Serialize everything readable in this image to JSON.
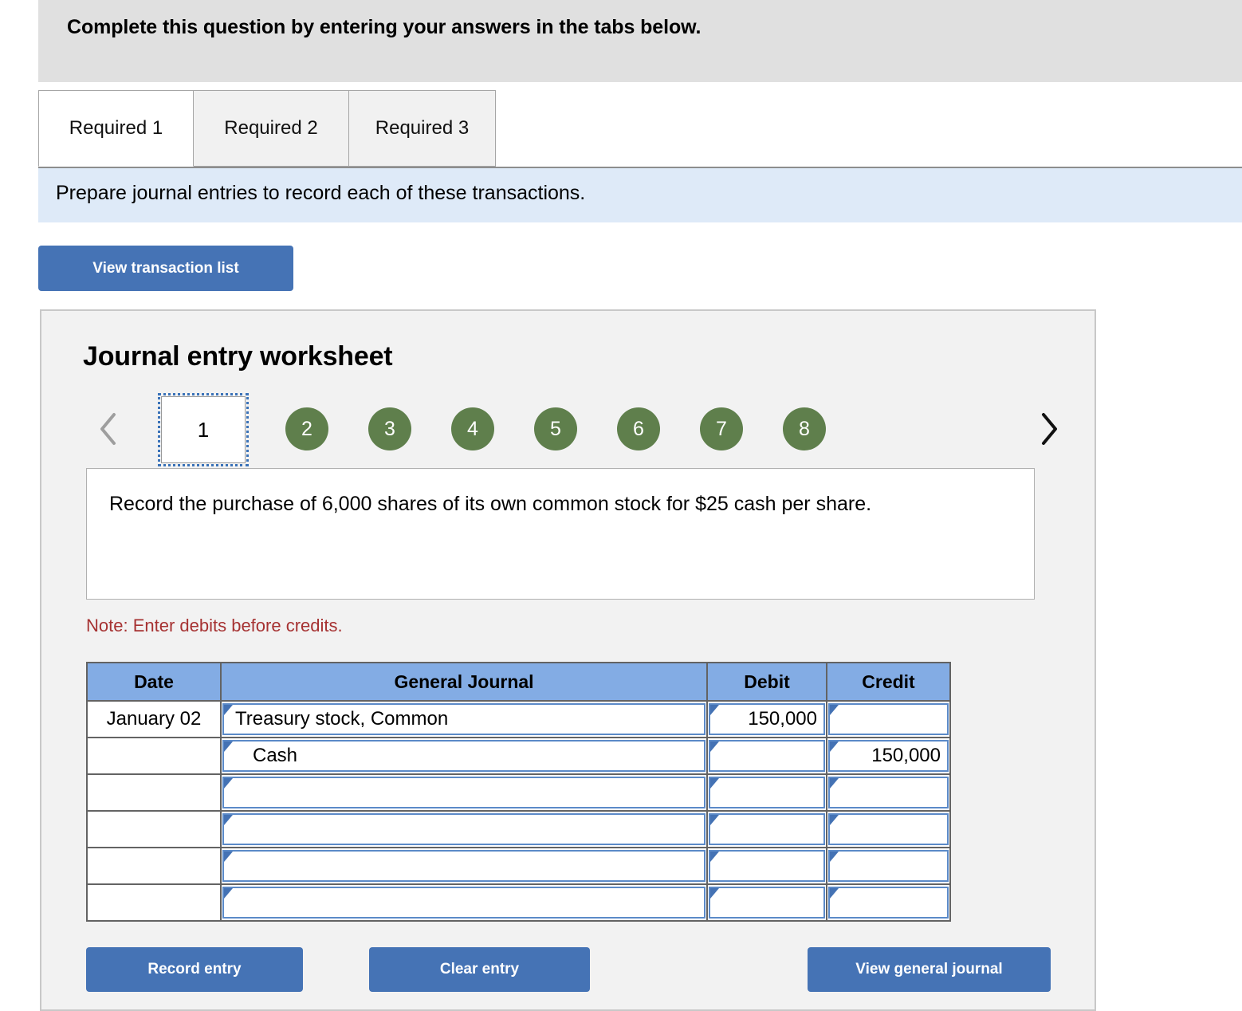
{
  "header": {
    "banner_text": "Complete this question by entering your answers in the tabs below."
  },
  "tabs": [
    {
      "label": "Required 1",
      "active": true
    },
    {
      "label": "Required 2",
      "active": false
    },
    {
      "label": "Required 3",
      "active": false
    }
  ],
  "instruction": {
    "text": "Prepare journal entries to record each of these transactions."
  },
  "toolbar": {
    "view_transaction_list_label": "View transaction list"
  },
  "worksheet": {
    "title": "Journal entry worksheet",
    "pager": {
      "prev_icon": "chevron-left-icon",
      "next_icon": "chevron-right-icon",
      "current": "1",
      "steps": [
        "1",
        "2",
        "3",
        "4",
        "5",
        "6",
        "7",
        "8"
      ]
    },
    "description": "Record the purchase of 6,000 shares of its own common stock for $25 cash per share.",
    "note": "Note: Enter debits before credits.",
    "table": {
      "columns": [
        "Date",
        "General Journal",
        "Debit",
        "Credit"
      ],
      "rows": [
        {
          "date": "January 02",
          "account": "Treasury stock, Common",
          "indent": false,
          "debit": "150,000",
          "credit": ""
        },
        {
          "date": "",
          "account": "Cash",
          "indent": true,
          "debit": "",
          "credit": "150,000"
        },
        {
          "date": "",
          "account": "",
          "indent": false,
          "debit": "",
          "credit": ""
        },
        {
          "date": "",
          "account": "",
          "indent": false,
          "debit": "",
          "credit": ""
        },
        {
          "date": "",
          "account": "",
          "indent": false,
          "debit": "",
          "credit": ""
        },
        {
          "date": "",
          "account": "",
          "indent": false,
          "debit": "",
          "credit": ""
        }
      ]
    },
    "buttons": {
      "record_entry_label": "Record entry",
      "clear_entry_label": "Clear entry",
      "view_general_journal_label": "View general journal"
    }
  },
  "colors": {
    "banner_bg": "#e0e0e0",
    "instruction_bg": "#deeaf8",
    "button_blue": "#4573b5",
    "table_header_blue": "#83ace4",
    "step_green": "#5f7f4c",
    "note_red": "#a63232",
    "panel_bg": "#f2f2f2",
    "input_border_blue": "#5b8ac8"
  }
}
